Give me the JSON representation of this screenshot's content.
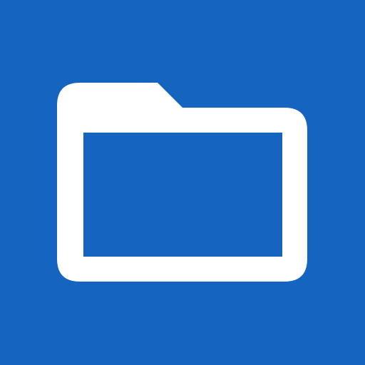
{
  "icon": {
    "name": "folder-icon",
    "background_color": "#1565C0",
    "glyph_color": "#FFFFFF"
  }
}
